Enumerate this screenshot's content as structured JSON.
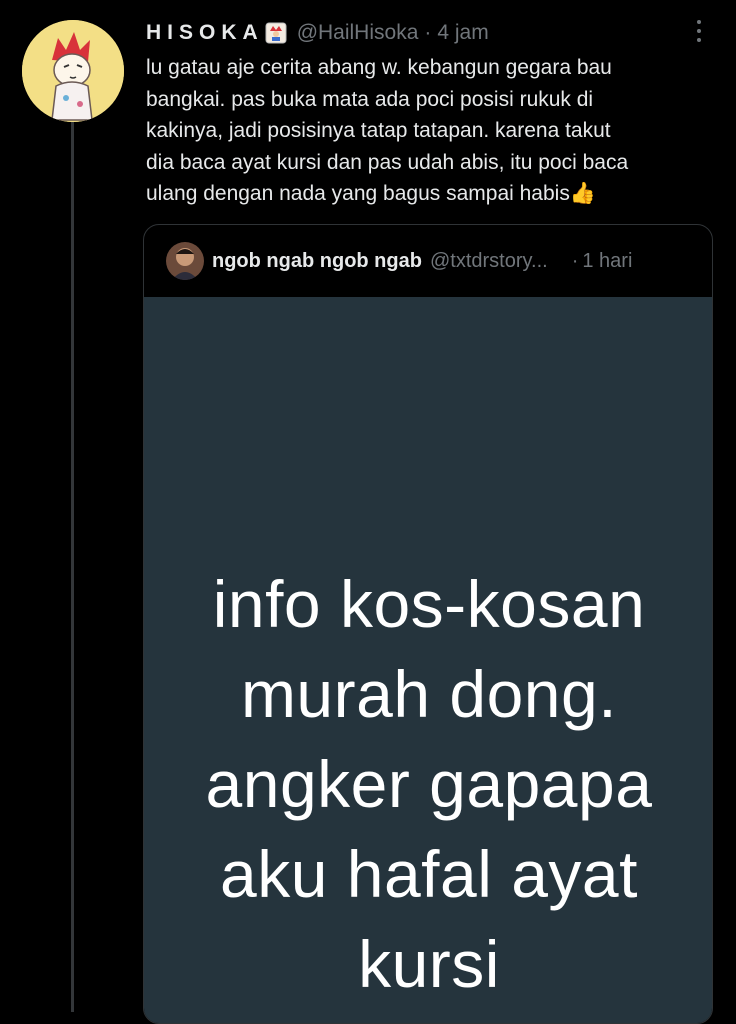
{
  "tweet": {
    "display_name": "HISOKA",
    "handle": "@HailHisoka",
    "separator": "·",
    "time": "4 jam",
    "name_emoji_icon": "joker-card-icon",
    "text": "lu gatau aje cerita abang w. kebangun gegara bau\nbangkai. pas buka mata ada poci posisi rukuk di\nkakinya, jadi posisinya tatap tatapan. karena takut\ndia baca ayat kursi dan pas udah abis, itu poci baca\nulang dengan nada yang bagus sampai habis👍"
  },
  "quote": {
    "display_name": "ngob ngab ngob ngab",
    "handle": "@txtdrstory...",
    "separator": "·",
    "time": "1 hari",
    "media_text": "info kos-kosan\nmurah dong.\nangker gapapa\naku hafal ayat\nkursi"
  },
  "colors": {
    "background": "#000000",
    "text_primary": "#e7e9ea",
    "text_secondary": "#71767b",
    "border": "#2f3336",
    "media_background": "#25343d",
    "avatar_background": "#f3df86"
  }
}
